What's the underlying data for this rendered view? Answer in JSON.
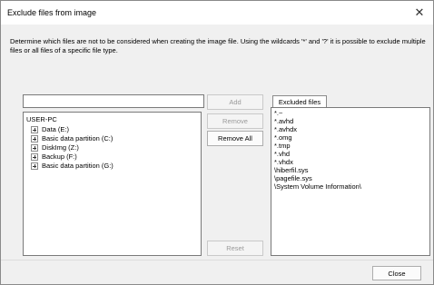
{
  "window": {
    "title": "Exclude files from image",
    "close_glyph": "✕"
  },
  "description": "Determine which files are not to be considered when creating the image file. Using the wildcards '*' and '?' it is possible to exclude multiple files or all files of a specific file type.",
  "path_input": {
    "value": "",
    "placeholder": ""
  },
  "buttons": {
    "add": "Add",
    "remove": "Remove",
    "remove_all": "Remove All",
    "reset": "Reset",
    "close": "Close"
  },
  "tree": {
    "root": "USER-PC",
    "items": [
      "Data (E:)",
      "Basic data partition (C:)",
      "DiskImg (Z:)",
      "Backup (F:)",
      "Basic data partition (G:)"
    ]
  },
  "excluded": {
    "tab_label": "Excluded files",
    "items": [
      "*.~",
      "*.avhd",
      "*.avhdx",
      "*.omg",
      "*.tmp",
      "*.vhd",
      "*.vhdx",
      "\\hiberfil.sys",
      "\\pagefile.sys",
      "\\System Volume Information\\"
    ]
  },
  "icons": {
    "tree_expander": "plus-box-icon",
    "window_close": "close-icon"
  }
}
